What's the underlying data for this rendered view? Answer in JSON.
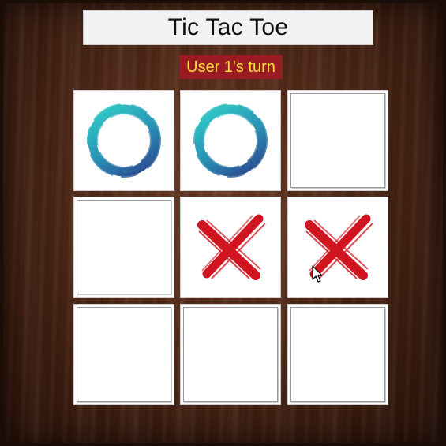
{
  "title": "Tic Tac Toe",
  "status": "User 1's turn",
  "colors": {
    "title_bg": "#f2f2f2",
    "status_bg": "#9a1b22",
    "status_text": "#f5e23a",
    "o_mark_light": "#2fc6c6",
    "o_mark_dark": "#2a4f92",
    "x_mark": "#d01420"
  },
  "board": [
    [
      "O",
      "O",
      ""
    ],
    [
      "",
      "X",
      "X"
    ],
    [
      "",
      "",
      ""
    ]
  ],
  "icons": {
    "o": "circle-brush-icon",
    "x": "cross-brush-icon",
    "cursor": "mouse-pointer-icon"
  }
}
